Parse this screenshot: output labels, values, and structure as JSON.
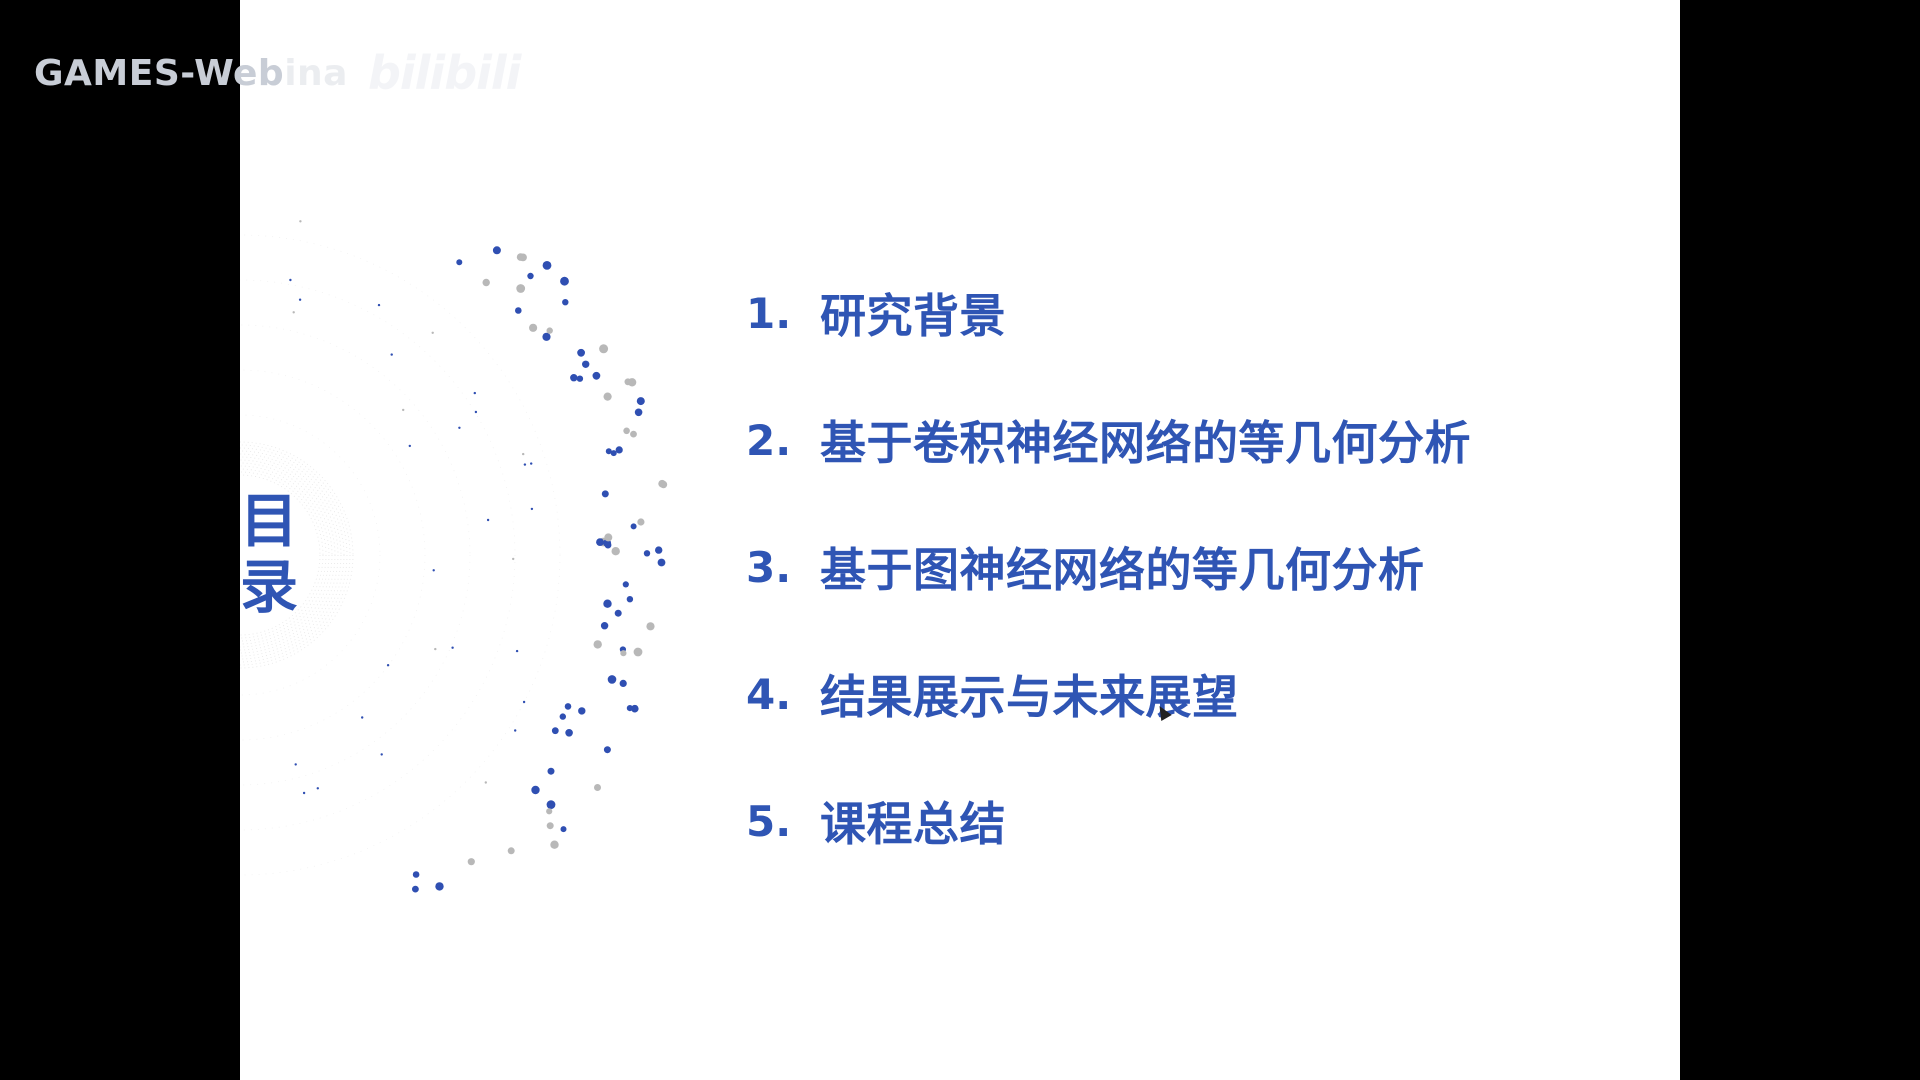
{
  "watermark": {
    "channel": "GAMES-Web",
    "channel_faded": "ina",
    "logo": "bilibili"
  },
  "slide": {
    "title_chars": [
      "目",
      "录"
    ],
    "items": [
      {
        "num": "1.",
        "text": "研究背景"
      },
      {
        "num": "2.",
        "text": "基于卷积神经网络的等几何分析"
      },
      {
        "num": "3.",
        "text": "基于图神经网络的等几何分析"
      },
      {
        "num": "4.",
        "text": "结果展示与未来展望"
      },
      {
        "num": "5.",
        "text": "课程总结"
      }
    ]
  },
  "colors": {
    "accent": "#2f55b4",
    "dot_blue": "#2f4fb2",
    "dot_gray": "#b8b8b8",
    "letterbox": "#000000",
    "slide_bg": "#ffffff"
  }
}
